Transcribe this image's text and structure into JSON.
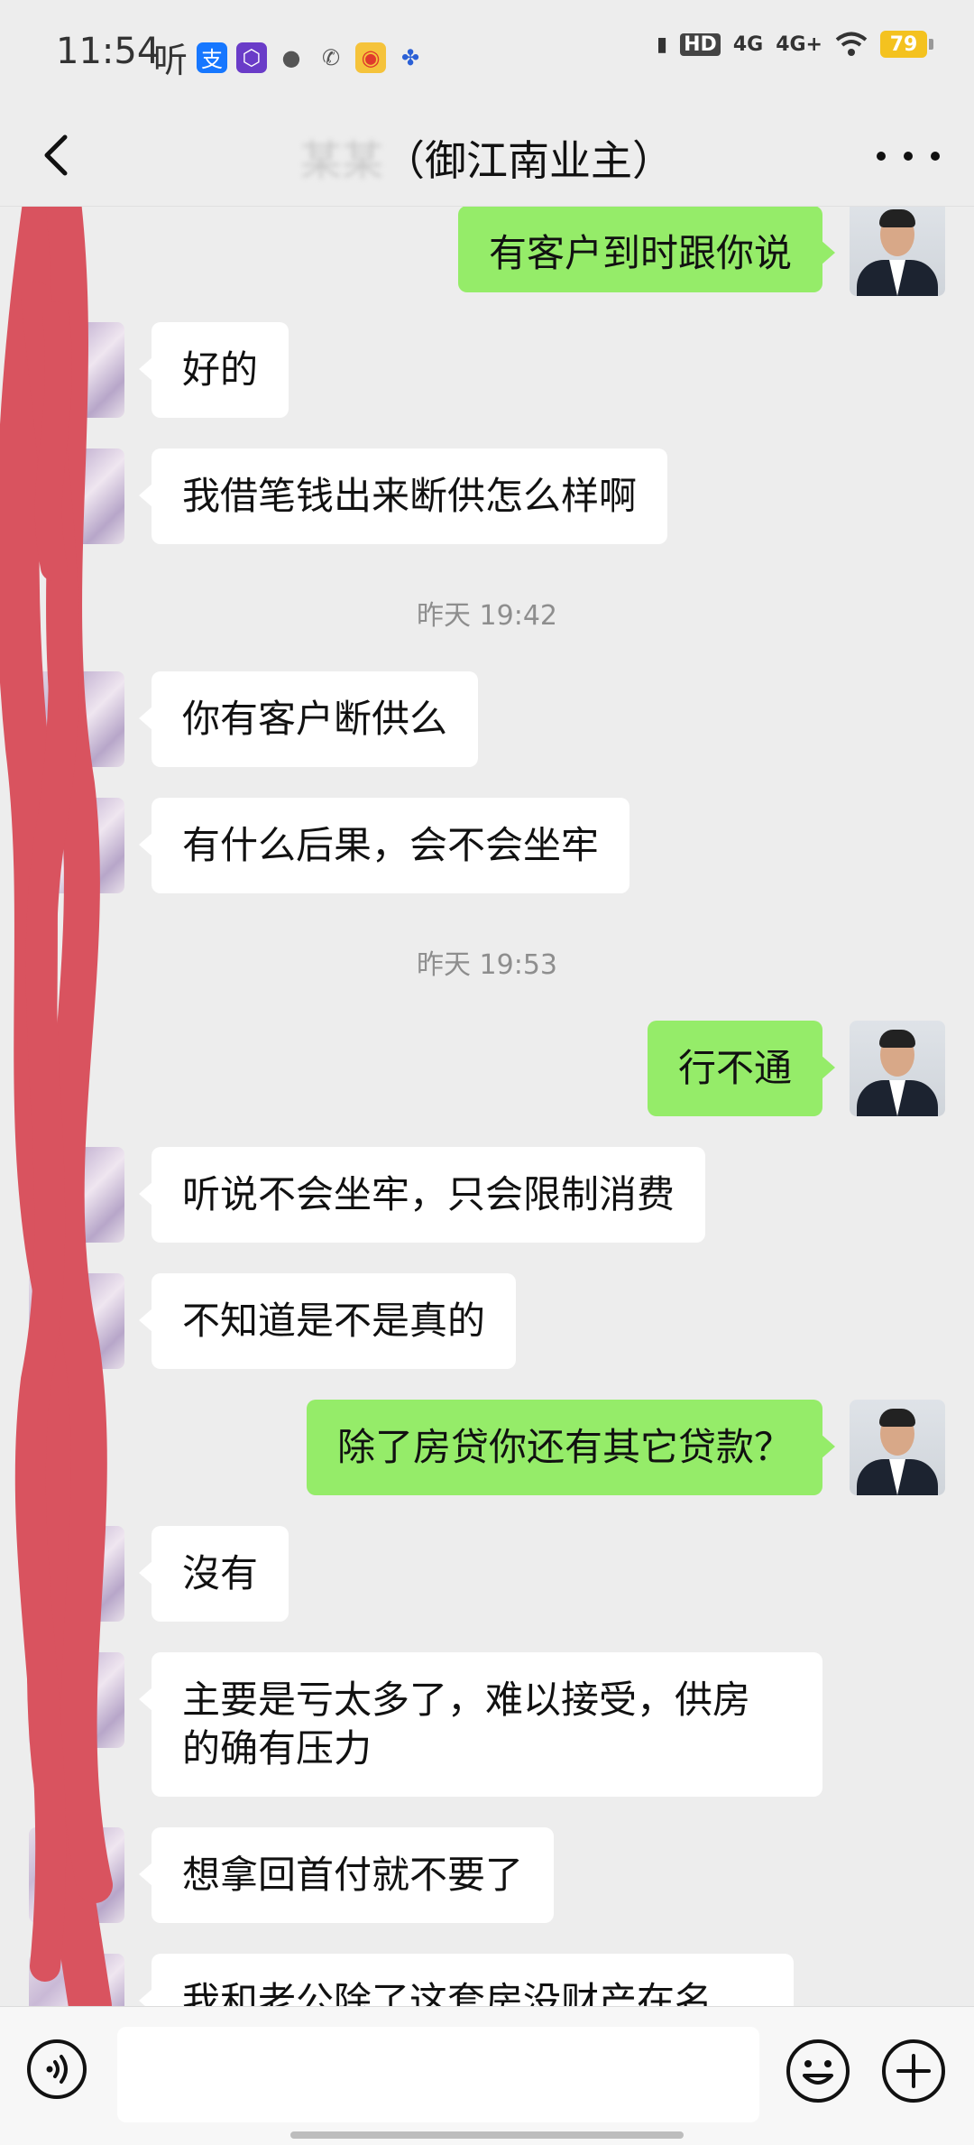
{
  "status_bar": {
    "time": "11:54",
    "left_text": "听",
    "network_labels": [
      "HD",
      "4G",
      "4G+"
    ],
    "battery": "79"
  },
  "nav": {
    "title_blurred": "某某",
    "title": "（御江南业主）"
  },
  "messages": [
    {
      "side": "out",
      "text": "有客户到时跟你说"
    },
    {
      "side": "in",
      "text": "好的"
    },
    {
      "side": "in",
      "text": "我借笔钱出来断供怎么样啊"
    },
    {
      "side": "time",
      "text": "昨天 19:42"
    },
    {
      "side": "in",
      "text": "你有客户断供么"
    },
    {
      "side": "in",
      "text": "有什么后果，会不会坐牢"
    },
    {
      "side": "time",
      "text": "昨天 19:53"
    },
    {
      "side": "out",
      "text": "行不通"
    },
    {
      "side": "in",
      "text": "听说不会坐牢，只会限制消费"
    },
    {
      "side": "in",
      "text": "不知道是不是真的"
    },
    {
      "side": "out",
      "text": "除了房贷你还有其它贷款？"
    },
    {
      "side": "in",
      "text": "沒有"
    },
    {
      "side": "in",
      "text": "主要是亏太多了，难以接受，供房\n的确有压力"
    },
    {
      "side": "in",
      "text": "想拿回首付就不要了"
    },
    {
      "side": "in",
      "text": "我和老公除了这套房没财产在名"
    }
  ],
  "colors": {
    "outgoing_bubble": "#95ec69",
    "incoming_bubble": "#ffffff",
    "background": "#ededed",
    "scribble": "#d9535f"
  }
}
